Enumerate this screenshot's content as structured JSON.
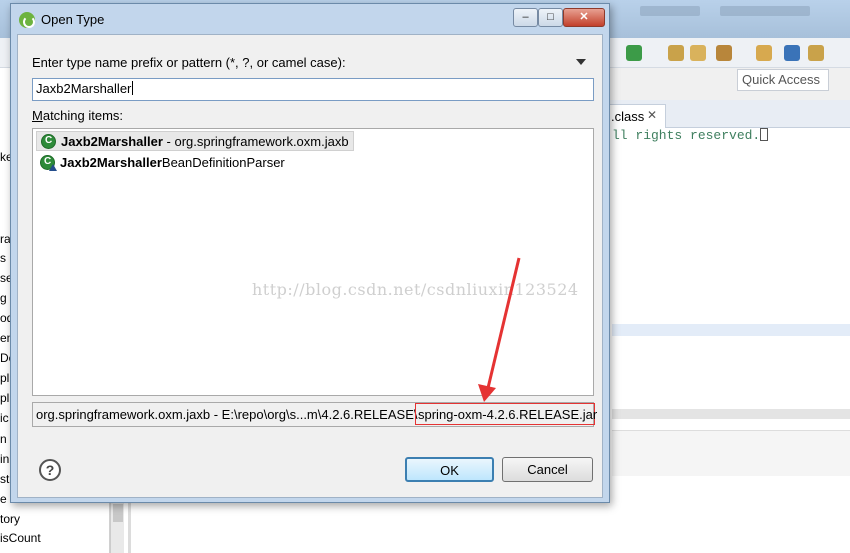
{
  "background": {
    "quick_access": "Quick Access",
    "editor_tab": ".class",
    "editor_tab_close": "✕",
    "editor_code": "ll rights reserved.",
    "tree_items": [
      "ke",
      "ra",
      "s",
      "se",
      "g",
      "od",
      "en",
      "De",
      "pl",
      "pl",
      "ic",
      "n",
      "in",
      "st",
      "e",
      "tory",
      "isCount"
    ]
  },
  "dialog": {
    "title": "Open Type",
    "min_label": "–",
    "max_label": "□",
    "close_label": "✕",
    "prompt_label": "Enter type name prefix or pattern (*, ?, or camel case):",
    "search_value": "Jaxb2Marshaller",
    "matching_label_u": "M",
    "matching_label_rest": "atching items:",
    "results": [
      {
        "name_bold": "Jaxb2Marshaller",
        "name_rest": " - org.springframework.oxm.jaxb",
        "icon": "class-icon",
        "selected": true
      },
      {
        "name_bold": "Jaxb2Marshaller",
        "name_rest": "BeanDefinitionParser",
        "icon": "class-warning-icon",
        "selected": false
      }
    ],
    "watermark": "http://blog.csdn.net/csdnliuxin123524",
    "path_prefix": "org.springframework.oxm.jaxb - E:\\repo\\org\\s...m\\4.2.6.RELEASE\\",
    "path_jar": "spring-oxm-4.2.6.RELEASE.jar",
    "help_label": "?",
    "ok_label": "OK",
    "cancel_label": "Cancel"
  },
  "colors": {
    "annotation_red": "#e53333",
    "title_bg": "#c2d6ec"
  }
}
